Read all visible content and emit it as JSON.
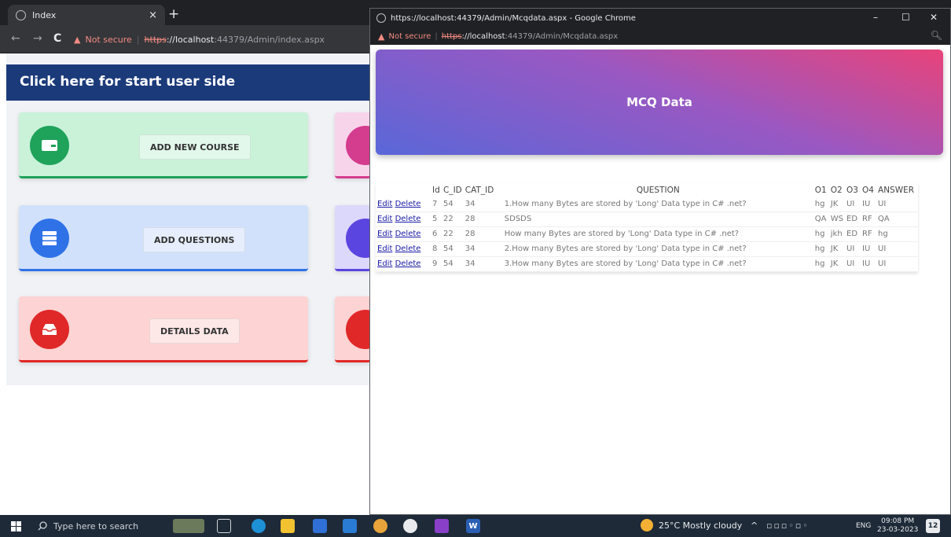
{
  "bg_browser": {
    "tab_title": "Index",
    "tab_close": "×",
    "new_tab": "+",
    "nav_back": "←",
    "nav_forward": "→",
    "nav_reload": "C",
    "warning": "▲",
    "not_secure": "Not secure",
    "separator": "|",
    "https": "https",
    "url_host": "://localhost",
    "url_rest": ":44379/Admin/index.aspx"
  },
  "admin": {
    "start_banner": "Click here for start user side",
    "cards": [
      {
        "label": "ADD NEW COURSE",
        "icon": "wallet-icon"
      },
      {
        "label": "ADD QUESTIONS",
        "icon": "database-icon"
      },
      {
        "label": "DETAILS DATA",
        "icon": "inbox-icon"
      }
    ]
  },
  "popup": {
    "window_title": "https://localhost:44379/Admin/Mcqdata.aspx - Google Chrome",
    "warning": "▲",
    "not_secure": "Not secure",
    "separator": "|",
    "https": "https",
    "url_host": "://localhost",
    "url_rest": ":44379/Admin/Mcqdata.aspx",
    "minimize": "–",
    "maximize": "☐",
    "close": "✕",
    "zoom": "🔍︎",
    "banner_title": "MCQ Data",
    "columns": [
      "Id",
      "C_ID",
      "CAT_ID",
      "QUESTION",
      "O1",
      "O2",
      "O3",
      "O4",
      "ANSWER"
    ],
    "edit_label": "Edit",
    "delete_label": "Delete",
    "rows": [
      {
        "id": "7",
        "c_id": "54",
        "cat_id": "34",
        "question": "1.How many Bytes are stored by 'Long' Data type in C# .net?",
        "o1": "hg",
        "o2": "JK",
        "o3": "UI",
        "o4": "IU",
        "answer": "UI"
      },
      {
        "id": "5",
        "c_id": "22",
        "cat_id": "28",
        "question": "SDSDS",
        "o1": "QA",
        "o2": "WS",
        "o3": "ED",
        "o4": "RF",
        "answer": "QA"
      },
      {
        "id": "6",
        "c_id": "22",
        "cat_id": "28",
        "question": "How many Bytes are stored by 'Long' Data type in C# .net?",
        "o1": "hg",
        "o2": "jkh",
        "o3": "ED",
        "o4": "RF",
        "answer": "hg"
      },
      {
        "id": "8",
        "c_id": "54",
        "cat_id": "34",
        "question": "2.How many Bytes are stored by 'Long' Data type in C# .net?",
        "o1": "hg",
        "o2": "JK",
        "o3": "UI",
        "o4": "IU",
        "answer": "UI"
      },
      {
        "id": "9",
        "c_id": "54",
        "cat_id": "34",
        "question": "3.How many Bytes are stored by 'Long' Data type in C# .net?",
        "o1": "hg",
        "o2": "JK",
        "o3": "UI",
        "o4": "IU",
        "answer": "UI"
      }
    ]
  },
  "taskbar": {
    "search_placeholder": "Type here to search",
    "weather": "25°C  Mostly cloudy",
    "tray_chevron": "^",
    "language": "ENG",
    "time": "09:08 PM",
    "date": "23-03-2023",
    "notifications": "12"
  },
  "colors": {
    "green": "#1fa25a",
    "blue": "#2f72e8",
    "red": "#e02828",
    "pink": "#d43c8e",
    "indigo": "#5a45e0",
    "banner_navy": "#1b3a7a"
  }
}
